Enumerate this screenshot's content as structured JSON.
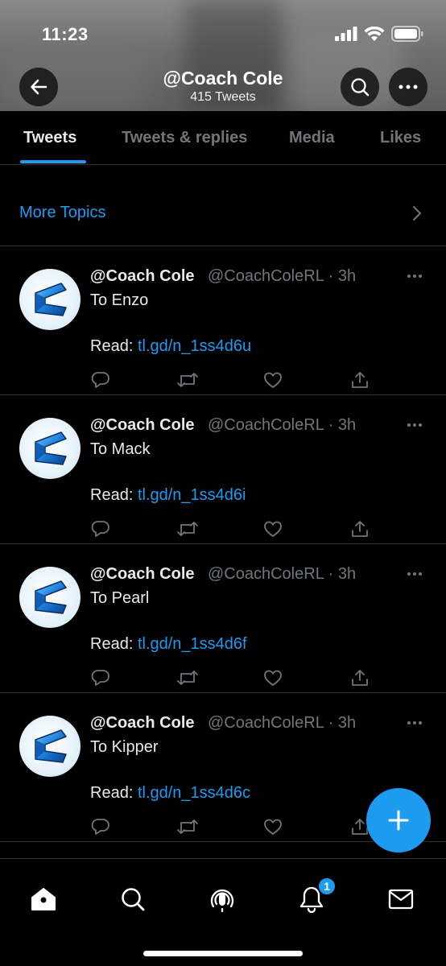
{
  "status": {
    "time": "11:23"
  },
  "header": {
    "title": "@Coach Cole",
    "subtitle": "415 Tweets"
  },
  "tabs": [
    {
      "label": "Tweets",
      "active": true
    },
    {
      "label": "Tweets & replies",
      "active": false
    },
    {
      "label": "Media",
      "active": false
    },
    {
      "label": "Likes",
      "active": false
    }
  ],
  "more_topics": {
    "label": "More Topics"
  },
  "tweets": [
    {
      "name": "@Coach Cole",
      "handle_time": "@CoachColeRL · 3h",
      "text": "To Enzo",
      "read_label": "Read:",
      "link": "tl.gd/n_1ss4d6u"
    },
    {
      "name": "@Coach Cole",
      "handle_time": "@CoachColeRL · 3h",
      "text": "To Mack",
      "read_label": "Read:",
      "link": "tl.gd/n_1ss4d6i"
    },
    {
      "name": "@Coach Cole",
      "handle_time": "@CoachColeRL · 3h",
      "text": "To Pearl",
      "read_label": "Read:",
      "link": "tl.gd/n_1ss4d6f"
    },
    {
      "name": "@Coach Cole",
      "handle_time": "@CoachColeRL · 3h",
      "text": "To Kipper",
      "read_label": "Read:",
      "link": "tl.gd/n_1ss4d6c"
    }
  ],
  "notifications": {
    "badge_count": "1"
  },
  "colors": {
    "accent": "#1d9bf0",
    "background": "#000000",
    "muted": "#71767b",
    "divider": "#2f3336"
  },
  "icons": [
    "back-arrow-icon",
    "search-icon",
    "more-icon",
    "reply-icon",
    "retweet-icon",
    "like-icon",
    "share-icon",
    "compose-icon",
    "home-icon",
    "explore-icon",
    "spaces-icon",
    "notifications-icon",
    "messages-icon"
  ]
}
